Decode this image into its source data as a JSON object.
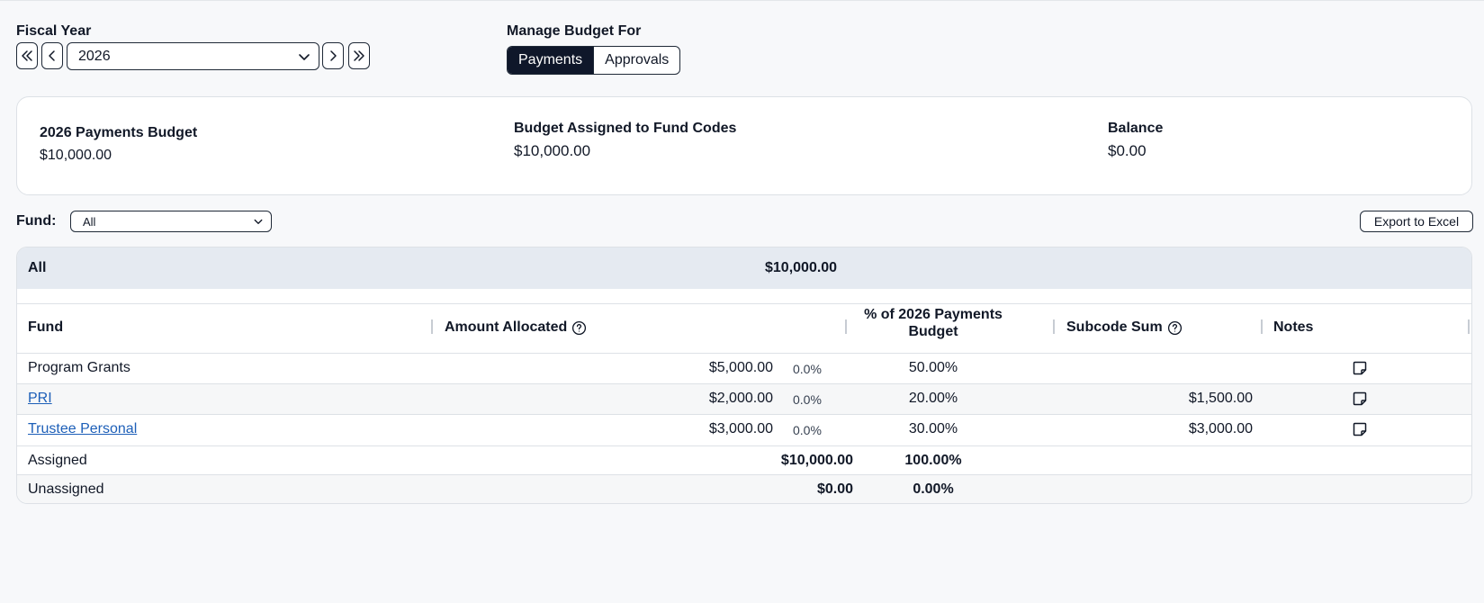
{
  "fiscal_year": {
    "label": "Fiscal Year",
    "selected": "2026"
  },
  "manage_budget": {
    "label": "Manage Budget For",
    "options": [
      "Payments",
      "Approvals"
    ],
    "active": "Payments"
  },
  "summary": {
    "budget_title": "2026 Payments Budget",
    "budget_value": "$10,000.00",
    "assigned_title": "Budget Assigned to Fund Codes",
    "assigned_value": "$10,000.00",
    "balance_title": "Balance",
    "balance_value": "$0.00"
  },
  "filter": {
    "fund_label": "Fund:",
    "fund_selected": "All",
    "export_label": "Export to Excel"
  },
  "table": {
    "group": {
      "name": "All",
      "amount": "$10,000.00"
    },
    "headers": {
      "fund": "Fund",
      "amount_allocated": "Amount Allocated",
      "percent_line1": "% of 2026 Payments",
      "percent_line2": "Budget",
      "subcode_sum": "Subcode Sum",
      "notes": "Notes"
    },
    "rows": [
      {
        "fund": "Program Grants",
        "is_link": false,
        "amount": "$5,000.00",
        "small_pct": "0.0%",
        "percent": "50.00%",
        "subcode_sum": ""
      },
      {
        "fund": "PRI",
        "is_link": true,
        "amount": "$2,000.00",
        "small_pct": "0.0%",
        "percent": "20.00%",
        "subcode_sum": "$1,500.00"
      },
      {
        "fund": "Trustee Personal",
        "is_link": true,
        "amount": "$3,000.00",
        "small_pct": "0.0%",
        "percent": "30.00%",
        "subcode_sum": "$3,000.00"
      }
    ],
    "assigned": {
      "label": "Assigned",
      "amount": "$10,000.00",
      "percent": "100.00%"
    },
    "unassigned": {
      "label": "Unassigned",
      "amount": "$0.00",
      "percent": "0.00%"
    }
  }
}
